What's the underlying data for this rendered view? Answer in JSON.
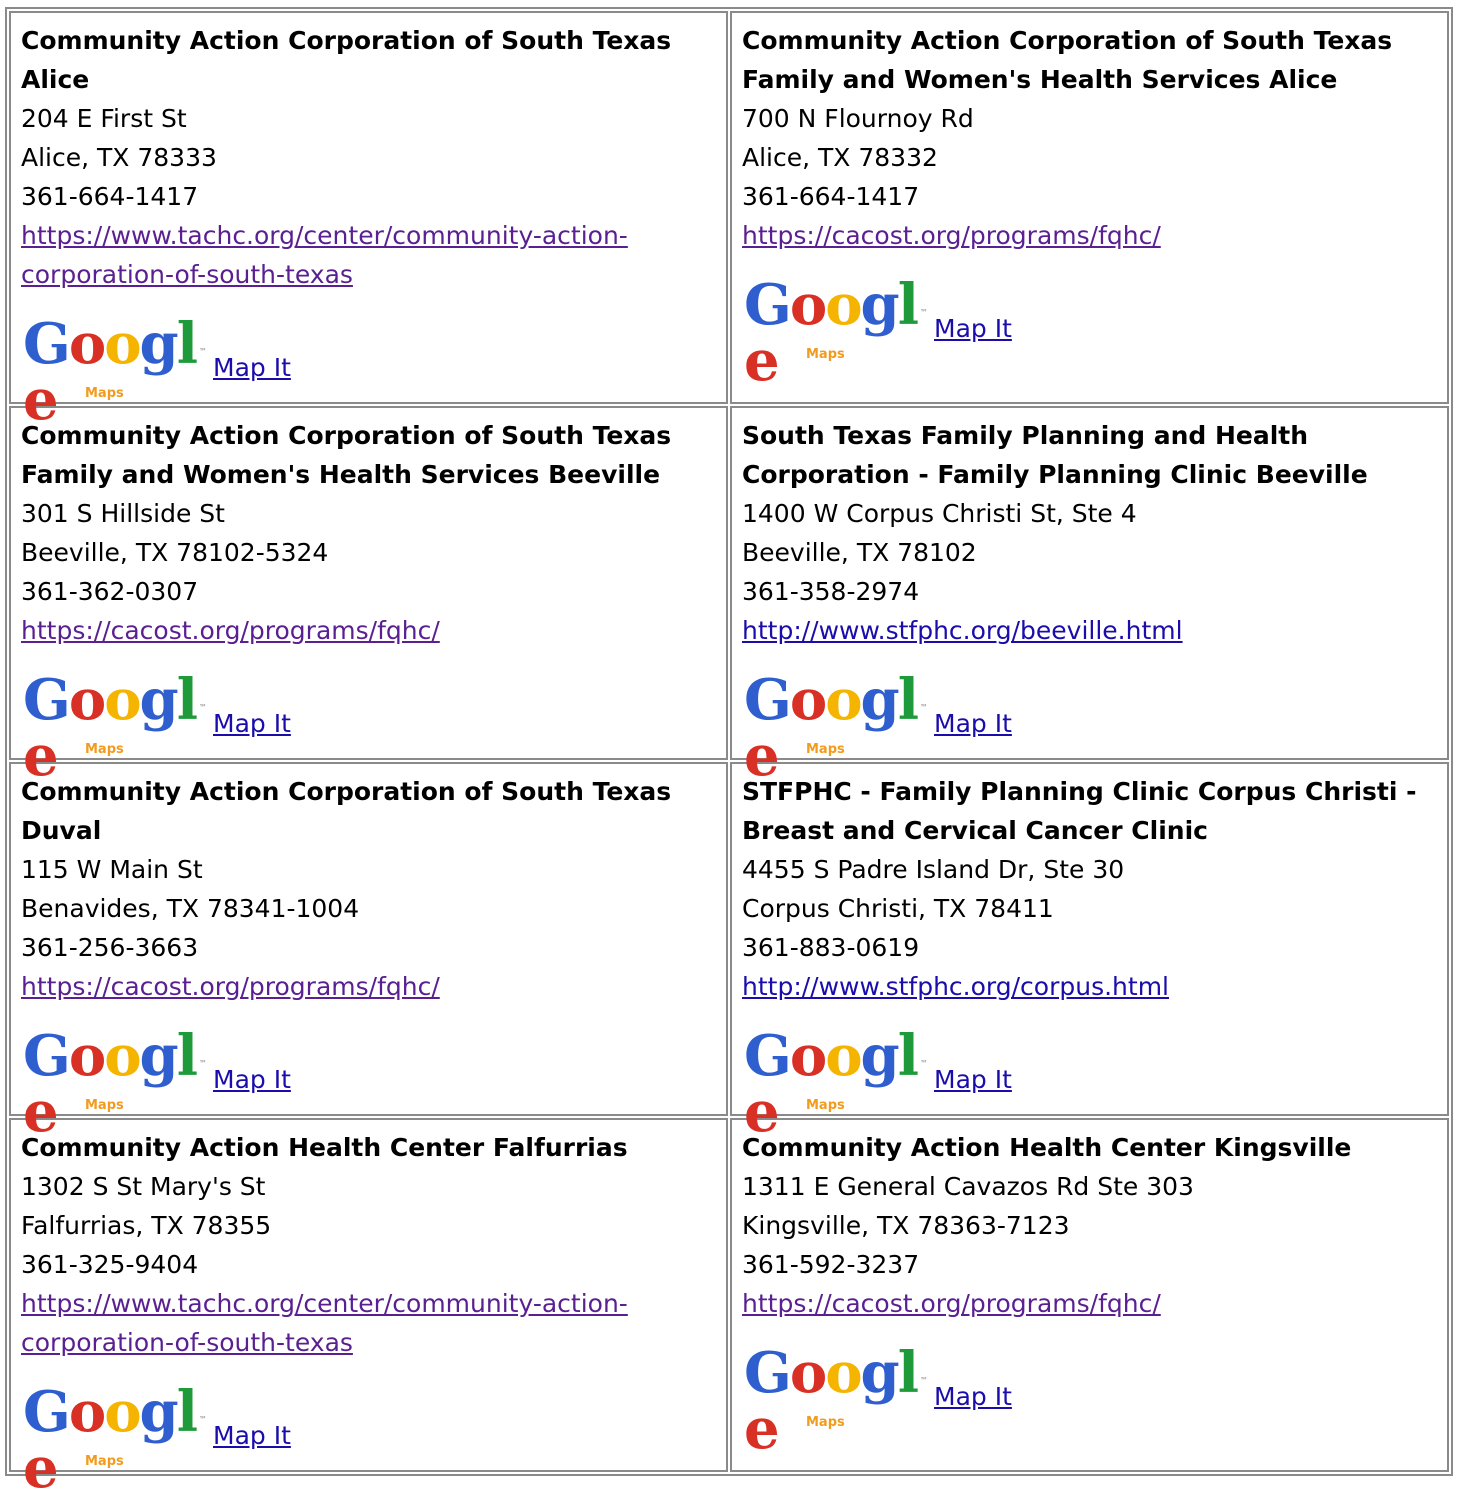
{
  "map_logo": {
    "word": [
      "G",
      "o",
      "o",
      "g",
      "l",
      "e"
    ],
    "sub": "Maps",
    "link_label": "Map It"
  },
  "clinics": [
    {
      "name": "Community Action Corporation of South Texas Alice",
      "address1": "204 E First St",
      "address2": "Alice, TX 78333",
      "phone": "361-664-1417",
      "url": "https://www.tachc.org/center/community-action-corporation-of-south-texas"
    },
    {
      "name": "Community Action Corporation of South Texas Family and Women's Health Services Alice",
      "address1": "700 N Flournoy Rd",
      "address2": "Alice, TX 78332",
      "phone": "361-664-1417",
      "url": "https://cacost.org/programs/fqhc/"
    },
    {
      "name": "Community Action Corporation of South Texas Family and Women's Health Services Beeville",
      "address1": "301 S Hillside St",
      "address2": "Beeville, TX 78102-5324",
      "phone": "361-362-0307",
      "url": "https://cacost.org/programs/fqhc/"
    },
    {
      "name": "South Texas Family Planning and Health Corporation - Family Planning Clinic Beeville",
      "address1": "1400 W Corpus Christi St, Ste 4",
      "address2": "Beeville, TX 78102",
      "phone": "361-358-2974",
      "url": "http://www.stfphc.org/beeville.html"
    },
    {
      "name": "Community Action Corporation of South Texas Duval",
      "address1": "115 W Main St",
      "address2": "Benavides, TX 78341-1004",
      "phone": "361-256-3663",
      "url": "https://cacost.org/programs/fqhc/"
    },
    {
      "name": "STFPHC - Family Planning Clinic Corpus Christi - Breast and Cervical Cancer Clinic",
      "address1": "4455 S Padre Island Dr, Ste 30",
      "address2": "Corpus Christi, TX 78411",
      "phone": "361-883-0619",
      "url": "http://www.stfphc.org/corpus.html"
    },
    {
      "name": "Community Action Health Center Falfurrias",
      "address1": "1302 S St Mary's St",
      "address2": "Falfurrias, TX 78355",
      "phone": "361-325-9404",
      "url": "https://www.tachc.org/center/community-action-corporation-of-south-texas"
    },
    {
      "name": "Community Action Health Center Kingsville",
      "address1": "1311 E General Cavazos Rd Ste 303",
      "address2": "Kingsville, TX 78363-7123",
      "phone": "361-592-3237",
      "url": "https://cacost.org/programs/fqhc/"
    }
  ]
}
